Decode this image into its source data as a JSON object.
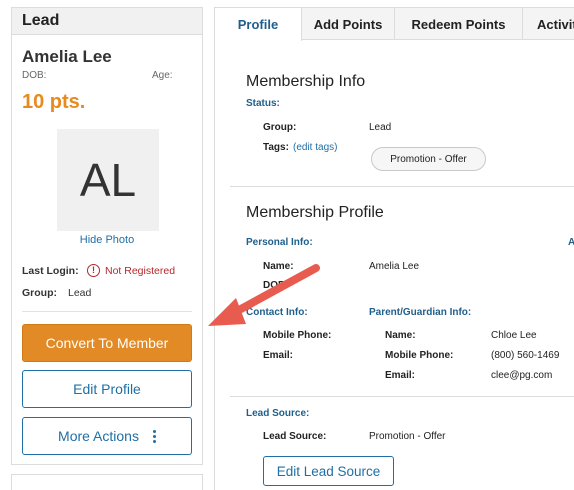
{
  "sidebar": {
    "header": "Lead",
    "name": "Amelia Lee",
    "dob_label": "DOB:",
    "age_label": "Age:",
    "points": "10 pts.",
    "initials": "AL",
    "hide_photo": "Hide Photo",
    "last_login_label": "Last Login:",
    "last_login_value": "Not Registered",
    "group_label": "Group:",
    "group_value": "Lead",
    "buttons": {
      "convert": "Convert To Member",
      "edit_profile": "Edit Profile",
      "more_actions": "More Actions"
    }
  },
  "tabs": [
    {
      "label": "Profile",
      "active": true
    },
    {
      "label": "Add Points"
    },
    {
      "label": "Redeem Points"
    },
    {
      "label": "Activit"
    }
  ],
  "membership_info": {
    "title": "Membership Info",
    "status_label": "Status:",
    "group_label": "Group:",
    "group_value": "Lead",
    "tags_label": "Tags:",
    "edit_tags": "(edit tags)",
    "tag": "Promotion - Offer"
  },
  "membership_profile": {
    "title": "Membership Profile",
    "personal_info_label": "Personal Info:",
    "right_cut_label": "A",
    "name_label": "Name:",
    "name_value": "Amelia Lee",
    "dob_label": "DOB:",
    "contact_info_label": "Contact Info:",
    "mobile_label": "Mobile Phone:",
    "email_label": "Email:",
    "guardian_label": "Parent/Guardian Info:",
    "guardian_name_label": "Name:",
    "guardian_name": "Chloe Lee",
    "guardian_mobile_label": "Mobile Phone:",
    "guardian_mobile": "(800) 560-1469",
    "guardian_email_label": "Email:",
    "guardian_email": "clee@pg.com"
  },
  "lead_source": {
    "section_label": "Lead Source:",
    "label": "Lead Source:",
    "value": "Promotion - Offer",
    "edit_button": "Edit Lead Source"
  },
  "colors": {
    "accent_orange": "#e28a25",
    "link_blue": "#1f6fa5",
    "label_blue": "#1f5f8b",
    "warning_red": "#b3282d",
    "annotation_arrow": "#e85c50"
  }
}
